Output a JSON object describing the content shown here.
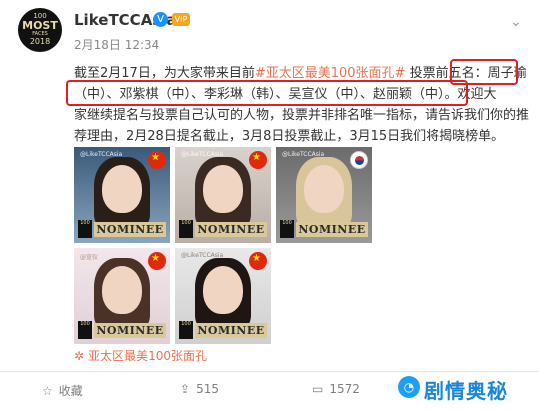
{
  "post": {
    "avatar": {
      "line1": "100",
      "line2": "MOST",
      "line3": "FACES",
      "line4": "2018"
    },
    "username": "LikeTCCAsia",
    "verified_icon": "V",
    "vip_icon": "VIP",
    "timestamp": "2月18日 12:34",
    "chevron_icon": "⌄",
    "text": {
      "l1_pre": "截至2月17日，为大家带来目前",
      "hashtag": "#亚太区最美100张面孔#",
      "l1_post": " 投票前五名：周子瑜",
      "line2": "（中）、邓紫棋（中）、李彩琳（韩）、吴宣仪（中）、赵丽颖（中）。欢迎大",
      "line3": "家继续提名与投票自己认可的人物，投票并非排名唯一指标，请告诉我们你的推",
      "line4": "荐理由，2月28日提名截止，3月8日投票截止，3月15日我们将揭晓榜单。"
    },
    "photos": [
      {
        "watermark": "@LikeTCCAsia",
        "flag": "cn",
        "nominee": "NOMINEE",
        "badge": "100"
      },
      {
        "watermark": "@LikeTCCAsia",
        "flag": "cn",
        "nominee": "NOMINEE",
        "badge": "100"
      },
      {
        "watermark": "@LikeTCCAsia",
        "flag": "kr",
        "nominee": "NOMINEE",
        "badge": "100"
      },
      {
        "watermark": "@宣仪",
        "flag": "cn",
        "nominee": "NOMINEE",
        "badge": "100"
      },
      {
        "watermark": "@LikeTCCAsia",
        "flag": "cn",
        "nominee": "NOMINEE",
        "badge": "100"
      }
    ],
    "topic": {
      "icon": "✲",
      "label": "亚太区最美100张面孔"
    }
  },
  "actions": {
    "favorite": {
      "icon": "☆",
      "label": "收藏"
    },
    "repost": {
      "icon": "⇪",
      "label": "515"
    },
    "comment": {
      "icon": "▭",
      "label": "1572"
    }
  },
  "brand": {
    "icon": "◔",
    "name": "剧情奥秘"
  },
  "colors": {
    "hashtag": "#eb7350",
    "highlight_box": "#e02020",
    "verified": "#1e90ff",
    "brand": "#1a86d8"
  }
}
